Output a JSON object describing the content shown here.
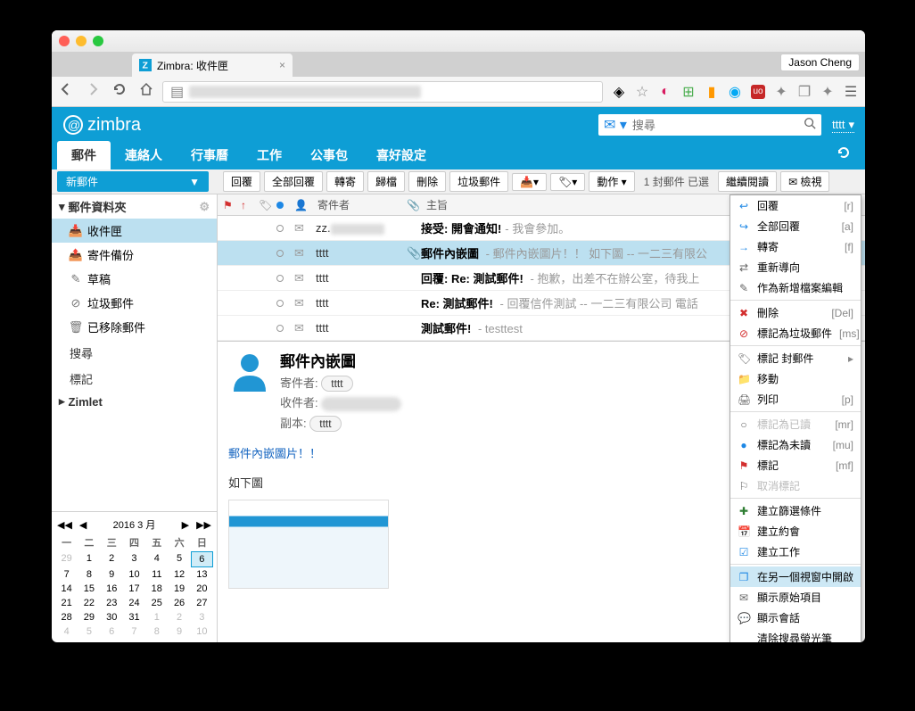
{
  "browser": {
    "tab_title": "Zimbra: 收件匣",
    "profile": "Jason Cheng"
  },
  "header": {
    "logo": "zimbra",
    "search_placeholder": "搜尋",
    "user": "tttt"
  },
  "main_tabs": [
    "郵件",
    "連絡人",
    "行事曆",
    "工作",
    "公事包",
    "喜好設定"
  ],
  "new_button": "新郵件",
  "toolbar": {
    "reply": "回覆",
    "reply_all": "全部回覆",
    "forward": "轉寄",
    "archive": "歸檔",
    "delete": "刪除",
    "spam": "垃圾郵件",
    "actions": "動作",
    "status": "1 封郵件 已選",
    "continue_read": "繼續閱讀",
    "view": "檢視"
  },
  "sidebar": {
    "folders_title": "郵件資料夾",
    "items": [
      {
        "label": "收件匣",
        "icon": "inbox"
      },
      {
        "label": "寄件備份",
        "icon": "sent"
      },
      {
        "label": "草稿",
        "icon": "draft"
      },
      {
        "label": "垃圾郵件",
        "icon": "junk"
      },
      {
        "label": "已移除郵件",
        "icon": "trash"
      }
    ],
    "search": "搜尋",
    "tags": "標記",
    "zimlet": "Zimlet"
  },
  "list_columns": {
    "from": "寄件者",
    "subject": "主旨"
  },
  "messages": [
    {
      "from": "zz.",
      "subject": "接受: 開會通知!",
      "snippet": "- 我會參加。",
      "read": true,
      "attach": false,
      "sel": false,
      "blur": true
    },
    {
      "from": "tttt",
      "subject": "郵件內嵌圖",
      "snippet": " - 郵件內嵌圖片！！ 如下圖 -- 一二三有限公",
      "read": true,
      "attach": true,
      "sel": true,
      "blur": false
    },
    {
      "from": "tttt",
      "subject": "回覆: Re: 測試郵件!",
      "snippet": " - 抱歉，出差不在辦公室，待我上",
      "read": true,
      "attach": false,
      "sel": false,
      "blur": false
    },
    {
      "from": "tttt",
      "subject": "Re: 測試郵件!",
      "snippet": " - 回覆信件測試 -- 一二三有限公司 電話",
      "read": true,
      "attach": false,
      "sel": false,
      "blur": false
    },
    {
      "from": "tttt",
      "subject": "測試郵件!",
      "snippet": " - testtest",
      "read": true,
      "attach": false,
      "sel": false,
      "blur": false
    }
  ],
  "preview": {
    "title": "郵件內嵌圖",
    "from_label": "寄件者:",
    "from": "tttt",
    "to_label": "收件者:",
    "cc_label": "副本:",
    "cc": "tttt",
    "body_line1": "郵件內嵌圖片！！",
    "body_line2": "如下圖"
  },
  "calendar": {
    "title": "2016 3 月",
    "dow": [
      "一",
      "二",
      "三",
      "四",
      "五",
      "六",
      "日"
    ],
    "weeks": [
      [
        {
          "d": 29,
          "o": true
        },
        {
          "d": 1
        },
        {
          "d": 2
        },
        {
          "d": 3
        },
        {
          "d": 4
        },
        {
          "d": 5
        },
        {
          "d": 6,
          "t": true
        }
      ],
      [
        {
          "d": 7
        },
        {
          "d": 8
        },
        {
          "d": 9
        },
        {
          "d": 10
        },
        {
          "d": 11
        },
        {
          "d": 12
        },
        {
          "d": 13
        }
      ],
      [
        {
          "d": 14
        },
        {
          "d": 15
        },
        {
          "d": 16
        },
        {
          "d": 17
        },
        {
          "d": 18
        },
        {
          "d": 19
        },
        {
          "d": 20
        }
      ],
      [
        {
          "d": 21
        },
        {
          "d": 22
        },
        {
          "d": 23
        },
        {
          "d": 24
        },
        {
          "d": 25
        },
        {
          "d": 26
        },
        {
          "d": 27
        }
      ],
      [
        {
          "d": 28
        },
        {
          "d": 29
        },
        {
          "d": 30
        },
        {
          "d": 31
        },
        {
          "d": 1,
          "o": true
        },
        {
          "d": 2,
          "o": true
        },
        {
          "d": 3,
          "o": true
        }
      ],
      [
        {
          "d": 4,
          "o": true
        },
        {
          "d": 5,
          "o": true
        },
        {
          "d": 6,
          "o": true
        },
        {
          "d": 7,
          "o": true
        },
        {
          "d": 8,
          "o": true
        },
        {
          "d": 9,
          "o": true
        },
        {
          "d": 10,
          "o": true
        }
      ]
    ]
  },
  "context_menu": [
    {
      "icon": "↩",
      "label": "回覆",
      "sc": "[r]",
      "color": "#1e88e5"
    },
    {
      "icon": "↪",
      "label": "全部回覆",
      "sc": "[a]",
      "color": "#1e88e5"
    },
    {
      "icon": "→",
      "label": "轉寄",
      "sc": "[f]",
      "color": "#1e88e5"
    },
    {
      "icon": "⇄",
      "label": "重新導向",
      "sc": ""
    },
    {
      "icon": "✎",
      "label": "作為新增檔案編輯",
      "sc": ""
    },
    {
      "sep": true
    },
    {
      "icon": "✖",
      "label": "刪除",
      "sc": "[Del]",
      "color": "#d32f2f"
    },
    {
      "icon": "⊘",
      "label": "標記為垃圾郵件",
      "sc": "[ms]",
      "color": "#d32f2f"
    },
    {
      "sep": true
    },
    {
      "icon": "🏷",
      "label": "標記 封郵件",
      "sc": "▸"
    },
    {
      "icon": "📁",
      "label": "移動",
      "sc": ""
    },
    {
      "icon": "🖨",
      "label": "列印",
      "sc": "[p]"
    },
    {
      "sep": true
    },
    {
      "icon": "○",
      "label": "標記為已讀",
      "sc": "[mr]",
      "dis": true
    },
    {
      "icon": "●",
      "label": "標記為未讀",
      "sc": "[mu]",
      "color": "#1e88e5"
    },
    {
      "icon": "⚑",
      "label": "標記",
      "sc": "[mf]",
      "color": "#d32f2f"
    },
    {
      "icon": "⚐",
      "label": "取消標記",
      "sc": "",
      "dis": true
    },
    {
      "sep": true
    },
    {
      "icon": "✚",
      "label": "建立篩選條件",
      "sc": "",
      "color": "#2e7d32"
    },
    {
      "icon": "📅",
      "label": "建立約會",
      "sc": ""
    },
    {
      "icon": "☑",
      "label": "建立工作",
      "sc": "",
      "color": "#1e88e5"
    },
    {
      "sep": true
    },
    {
      "icon": "❐",
      "label": "在另一個視窗中開啟",
      "sc": "",
      "hov": true,
      "color": "#1e88e5"
    },
    {
      "icon": "✉",
      "label": "顯示原始項目",
      "sc": ""
    },
    {
      "icon": "💬",
      "label": "顯示會話",
      "sc": ""
    },
    {
      "icon": "",
      "label": "清除搜尋螢光筆",
      "sc": ""
    }
  ]
}
